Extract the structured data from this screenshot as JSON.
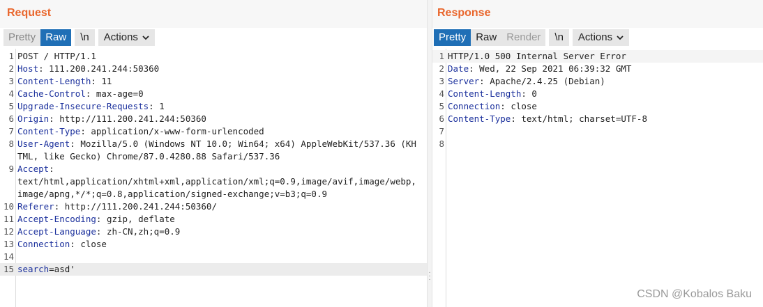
{
  "request": {
    "title": "Request",
    "view_tabs": [
      {
        "label": "Pretty",
        "state": "inactive"
      },
      {
        "label": "Raw",
        "state": "active"
      }
    ],
    "newline_label": "\\n",
    "actions_label": "Actions",
    "lines": [
      {
        "num": "1",
        "key": "",
        "rest": "POST / HTTP/1.1"
      },
      {
        "num": "2",
        "key": "Host",
        "rest": ": 111.200.241.244:50360"
      },
      {
        "num": "3",
        "key": "Content-Length",
        "rest": ": 11"
      },
      {
        "num": "4",
        "key": "Cache-Control",
        "rest": ": max-age=0"
      },
      {
        "num": "5",
        "key": "Upgrade-Insecure-Requests",
        "rest": ": 1"
      },
      {
        "num": "6",
        "key": "Origin",
        "rest": ": http://111.200.241.244:50360"
      },
      {
        "num": "7",
        "key": "Content-Type",
        "rest": ": application/x-www-form-urlencoded"
      },
      {
        "num": "8",
        "key": "User-Agent",
        "rest": ": Mozilla/5.0 (Windows NT 10.0; Win64; x64) AppleWebKit/537.36 (KHTML, like Gecko) Chrome/87.0.4280.88 Safari/537.36"
      },
      {
        "num": "9",
        "key": "Accept",
        "rest": ":\ntext/html,application/xhtml+xml,application/xml;q=0.9,image/avif,image/webp,image/apng,*/*;q=0.8,application/signed-exchange;v=b3;q=0.9"
      },
      {
        "num": "10",
        "key": "Referer",
        "rest": ": http://111.200.241.244:50360/"
      },
      {
        "num": "11",
        "key": "Accept-Encoding",
        "rest": ": gzip, deflate"
      },
      {
        "num": "12",
        "key": "Accept-Language",
        "rest": ": zh-CN,zh;q=0.9"
      },
      {
        "num": "13",
        "key": "Connection",
        "rest": ": close"
      },
      {
        "num": "14",
        "key": "",
        "rest": ""
      },
      {
        "num": "15",
        "key": "search",
        "rest": "=asd'"
      }
    ]
  },
  "response": {
    "title": "Response",
    "view_tabs": [
      {
        "label": "Pretty",
        "state": "active"
      },
      {
        "label": "Raw",
        "state": "inactive"
      },
      {
        "label": "Render",
        "state": "disabled"
      }
    ],
    "newline_label": "\\n",
    "actions_label": "Actions",
    "lines": [
      {
        "num": "1",
        "key": "",
        "rest": "HTTP/1.0 500 Internal Server Error"
      },
      {
        "num": "2",
        "key": "Date",
        "rest": ": Wed, 22 Sep 2021 06:39:32 GMT"
      },
      {
        "num": "3",
        "key": "Server",
        "rest": ": Apache/2.4.25 (Debian)"
      },
      {
        "num": "4",
        "key": "Content-Length",
        "rest": ": 0"
      },
      {
        "num": "5",
        "key": "Connection",
        "rest": ": close"
      },
      {
        "num": "6",
        "key": "Content-Type",
        "rest": ": text/html; charset=UTF-8"
      },
      {
        "num": "7",
        "key": "",
        "rest": ""
      },
      {
        "num": "8",
        "key": "",
        "rest": ""
      }
    ]
  },
  "watermark": "CSDN @Kobalos Baku",
  "icons": {
    "actions": "chevron-down-icon",
    "splitter": "drag-handle-icon"
  },
  "colors": {
    "title": "#e9662c",
    "active_tab": "#1f6fb6",
    "header_key": "#1a2f9c"
  }
}
